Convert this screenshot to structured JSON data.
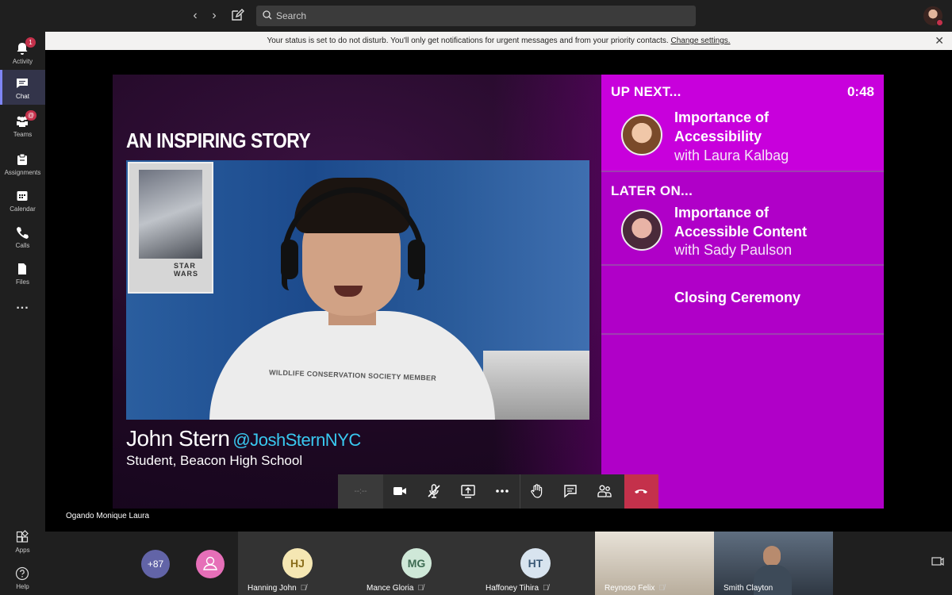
{
  "search": {
    "placeholder": "Search"
  },
  "rail": {
    "items": [
      {
        "label": "Activity",
        "badge": "1"
      },
      {
        "label": "Chat",
        "badge": ""
      },
      {
        "label": "Teams",
        "badge": "@"
      },
      {
        "label": "Assignments",
        "badge": ""
      },
      {
        "label": "Calendar",
        "badge": ""
      },
      {
        "label": "Calls",
        "badge": ""
      },
      {
        "label": "Files",
        "badge": ""
      },
      {
        "label": "Apps",
        "badge": ""
      },
      {
        "label": "Help",
        "badge": ""
      }
    ],
    "more_label": "..."
  },
  "notice": {
    "text": "Your status is set to do not disturb. You'll only get notifications for urgent messages and from your priority contacts.",
    "link": "Change settings."
  },
  "video": {
    "story_title": "AN INSPIRING STORY",
    "poster_text": "STAR WARS",
    "shirt_text": "WILDLIFE CONSERVATION SOCIETY MEMBER",
    "speaker_name": "John Stern",
    "speaker_handle": "@JoshSternNYC",
    "speaker_role": "Student, Beacon High School"
  },
  "panel": {
    "up_next_heading": "UP NEXT...",
    "countdown": "0:48",
    "up_next_title_1": "Importance of",
    "up_next_title_2": "Accessibility",
    "up_next_presenter": "with Laura Kalbag",
    "later_heading": "LATER ON...",
    "later_title_1": "Importance of",
    "later_title_2": "Accessible Content",
    "later_presenter": "with Sady Paulson",
    "closing": "Closing Ceremony"
  },
  "controls": {
    "timer": "--:--"
  },
  "presenter": "Ogando Monique Laura",
  "participants": {
    "more_count": "+87",
    "tiles": [
      {
        "initials": "HJ",
        "name": "Hanning John",
        "color": "#f5e7b3",
        "text_color": "#8a6d1b"
      },
      {
        "initials": "MG",
        "name": "Mance Gloria",
        "color": "#cfe8d8",
        "text_color": "#3d6b52"
      },
      {
        "initials": "HT",
        "name": "Haffoney Tihira",
        "color": "#d8e4ef",
        "text_color": "#3c5a78"
      },
      {
        "initials": "",
        "name": "Reynoso Felix"
      },
      {
        "initials": "",
        "name": "Smith Clayton"
      }
    ]
  },
  "colors": {
    "accent": "#6264a7",
    "panel": "#b000c8",
    "hangup": "#c4314b",
    "handle": "#39c9f0"
  }
}
